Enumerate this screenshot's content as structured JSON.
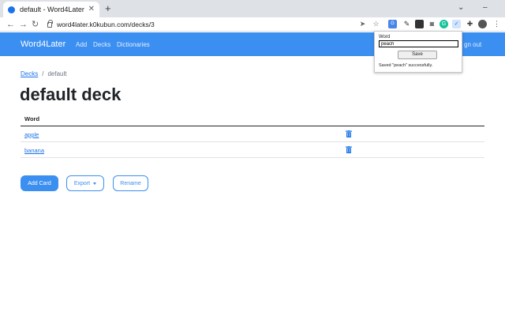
{
  "browser": {
    "tab_title": "default - Word4Later",
    "url": "word4later.k0kubun.com/decks/3"
  },
  "nav": {
    "brand": "Word4Later",
    "links": [
      "Add",
      "Decks",
      "Dictionaries"
    ],
    "signout": "gn out"
  },
  "breadcrumb": {
    "root": "Decks",
    "separator": "/",
    "current": "default"
  },
  "page": {
    "title": "default deck"
  },
  "table": {
    "header": "Word",
    "rows": [
      {
        "word": "apple"
      },
      {
        "word": "banana"
      }
    ]
  },
  "actions": {
    "add_card": "Add Card",
    "export": "Export",
    "rename": "Rename"
  },
  "popup": {
    "label": "Word",
    "input_value": "peach",
    "save": "Save",
    "status": "Saved \"peach\" successfully."
  },
  "colors": {
    "primary": "#3b8ff0",
    "link": "#1a73e8"
  },
  "icons": [
    "send-icon",
    "star-icon",
    "google-translate-icon",
    "extension-icon",
    "camera-icon",
    "grammarly-icon",
    "word4later-icon",
    "puzzle-icon",
    "profile-icon",
    "menu-icon",
    "trash-icon"
  ]
}
